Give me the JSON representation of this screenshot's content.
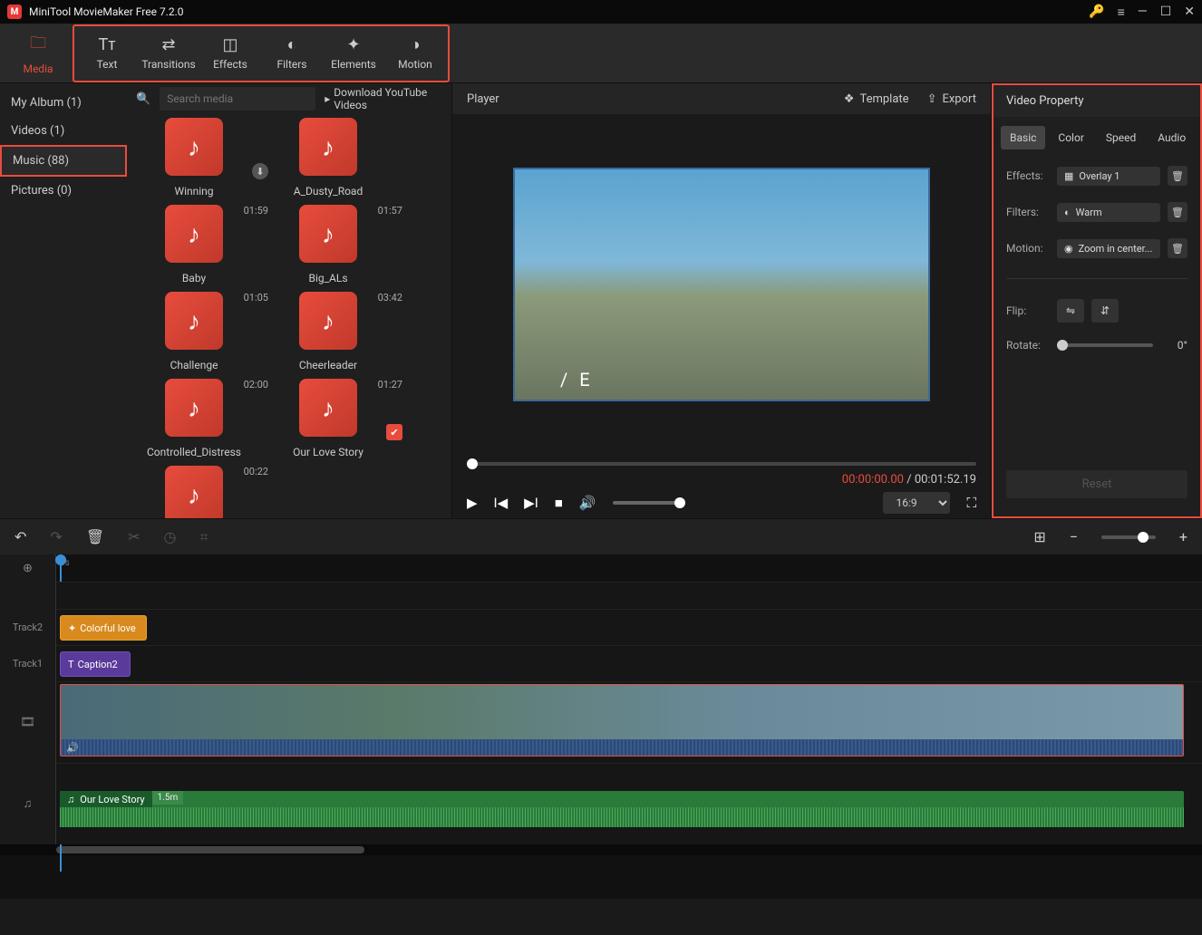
{
  "app": {
    "title": "MiniTool MovieMaker Free 7.2.0"
  },
  "toolbar": {
    "media": "Media",
    "text": "Text",
    "transitions": "Transitions",
    "effects": "Effects",
    "filters": "Filters",
    "elements": "Elements",
    "motion": "Motion"
  },
  "sidebar": {
    "items": [
      {
        "label": "My Album (1)"
      },
      {
        "label": "Videos (1)"
      },
      {
        "label": "Music (88)"
      },
      {
        "label": "Pictures (0)"
      }
    ]
  },
  "mediaPanel": {
    "searchPlaceholder": "Search media",
    "downloadLink": "Download YouTube Videos",
    "items": [
      {
        "name": "Winning",
        "dur": "",
        "download": true
      },
      {
        "name": "A_Dusty_Road",
        "dur": ""
      },
      {
        "name": "Baby",
        "dur": "01:59"
      },
      {
        "name": "Big_ALs",
        "dur": "01:57"
      },
      {
        "name": "Challenge",
        "dur": "01:05"
      },
      {
        "name": "Cheerleader",
        "dur": "03:42"
      },
      {
        "name": "Controlled_Distress",
        "dur": "02:00"
      },
      {
        "name": "Our Love Story",
        "dur": "01:27",
        "checked": true
      },
      {
        "name": "",
        "dur": "00:22"
      }
    ]
  },
  "player": {
    "label": "Player",
    "template": "Template",
    "export": "Export",
    "curTime": "00:00:00.00",
    "totalTime": "00:01:52.19",
    "aspect": "16:9"
  },
  "props": {
    "title": "Video Property",
    "tabs": {
      "basic": "Basic",
      "color": "Color",
      "speed": "Speed",
      "audio": "Audio"
    },
    "effects": {
      "lbl": "Effects:",
      "val": "Overlay 1"
    },
    "filters": {
      "lbl": "Filters:",
      "val": "Warm"
    },
    "motion": {
      "lbl": "Motion:",
      "val": "Zoom in center..."
    },
    "flip": "Flip:",
    "rotate": {
      "lbl": "Rotate:",
      "val": "0°"
    },
    "reset": "Reset"
  },
  "tracks": {
    "t2": "Track2",
    "t1": "Track1",
    "clip_orange": "Colorful love",
    "clip_purple": "Caption2",
    "audio_name": "Our Love Story",
    "audio_dur": "1.5m",
    "ruler_start": "0s"
  }
}
